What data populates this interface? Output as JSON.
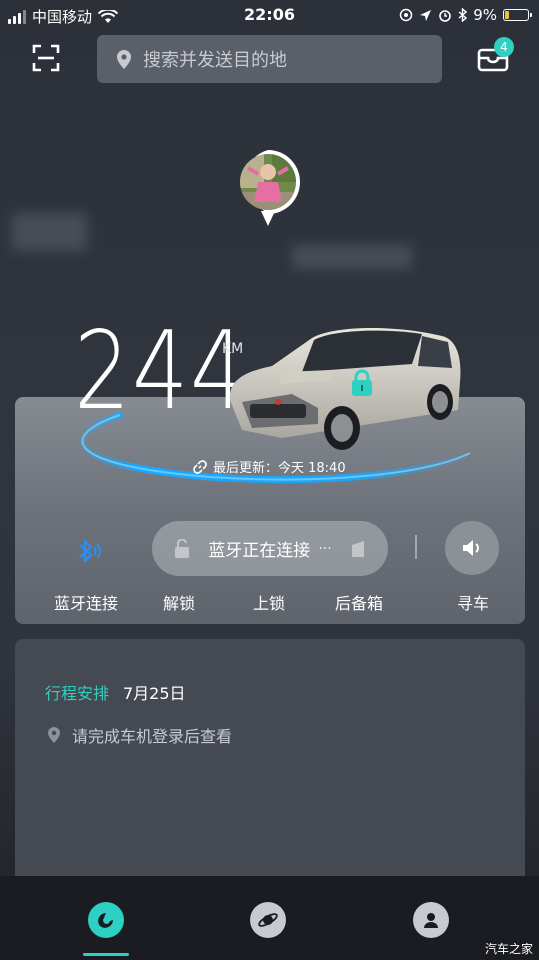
{
  "status_bar": {
    "carrier": "中国移动",
    "time": "22:06",
    "battery": "9%"
  },
  "header": {
    "search_placeholder": "搜索并发送目的地",
    "message_count": "4"
  },
  "vehicle": {
    "range_value": "244",
    "range_unit": "KM",
    "last_update_label": "最后更新：今天 18:40"
  },
  "controls": {
    "connecting_status": "蓝牙正在连接",
    "connecting_dots": "···",
    "bluetooth_label": "蓝牙连接",
    "unlock_label": "解锁",
    "lock_label": "上锁",
    "trunk_label": "后备箱",
    "find_car_label": "寻车"
  },
  "trip": {
    "title": "行程安排",
    "date": "7月25日",
    "hint": "请完成车机登录后查看"
  },
  "watermark": "汽车之家",
  "colors": {
    "accent": "#2fd0c4",
    "bluetooth": "#2c8ff0"
  },
  "icons": {
    "scan": "scan-icon",
    "location": "location-pin-icon",
    "message": "message-box-icon",
    "link": "link-icon",
    "bluetooth": "bluetooth-icon",
    "lock": "lock-icon",
    "speaker": "speaker-icon",
    "tab_car": "car-tab-icon",
    "tab_discover": "planet-tab-icon",
    "tab_profile": "profile-tab-icon"
  }
}
